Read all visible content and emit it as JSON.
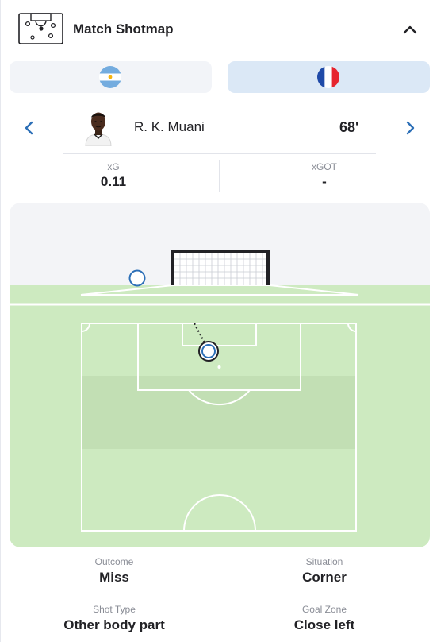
{
  "header": {
    "title": "Match Shotmap",
    "icon": "shotmap-icon",
    "collapse_icon": "chevron-up-icon"
  },
  "teams": [
    {
      "flag_icon": "argentina-flag-icon",
      "selected": false
    },
    {
      "flag_icon": "france-flag-icon",
      "selected": true
    }
  ],
  "player": {
    "name": "R. K. Muani",
    "minute": "68'"
  },
  "stats": {
    "xg_label": "xG",
    "xg_value": "0.11",
    "xgot_label": "xGOT",
    "xgot_value": "-"
  },
  "details": {
    "outcome_label": "Outcome",
    "outcome_value": "Miss",
    "situation_label": "Situation",
    "situation_value": "Corner",
    "shot_type_label": "Shot Type",
    "shot_type_value": "Other body part",
    "goal_zone_label": "Goal Zone",
    "goal_zone_value": "Close left"
  },
  "colors": {
    "pitch_green": "#cdeac0",
    "pitch_stripe": "#c2dfb4",
    "goal_bg": "#f3f4f7",
    "accent_blue": "#2c6fb7",
    "text_primary": "#222226",
    "text_secondary": "#8a8d96"
  }
}
